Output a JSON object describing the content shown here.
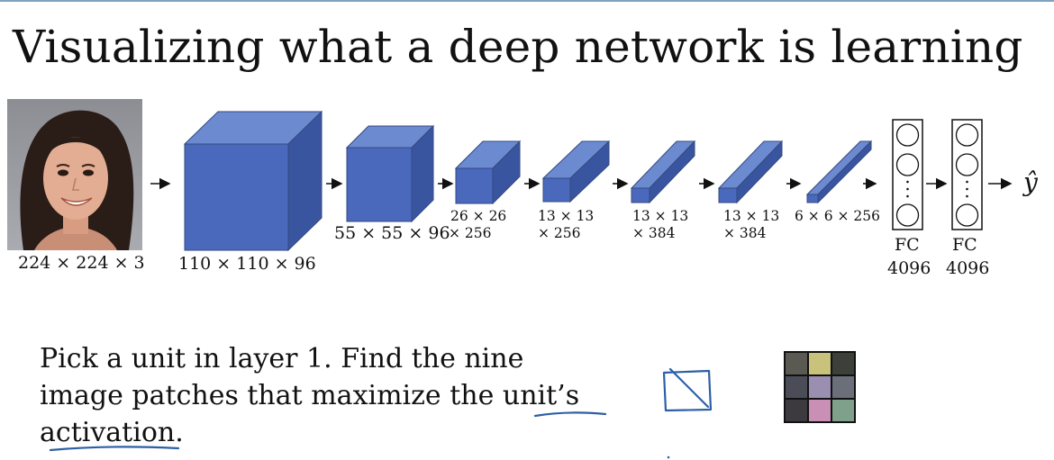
{
  "slide": {
    "title": "Visualizing what a deep network is learning"
  },
  "network": {
    "input_dim": "224 × 224 × 3",
    "layers": [
      {
        "line1": "110 × 110 × 96",
        "line2": ""
      },
      {
        "line1": "55 × 55 × 96",
        "line2": ""
      },
      {
        "line1": "26 × 26",
        "line2": "× 256"
      },
      {
        "line1": "13 × 13",
        "line2": "× 256"
      },
      {
        "line1": "13 × 13",
        "line2": "× 384"
      },
      {
        "line1": "13 × 13",
        "line2": "× 384"
      },
      {
        "line1": "6 × 6 × 256",
        "line2": ""
      }
    ],
    "fc": [
      {
        "label": "FC",
        "size": "4096"
      },
      {
        "label": "FC",
        "size": "4096"
      }
    ],
    "output_symbol": "ŷ",
    "colors": {
      "cube_front": "#4a69bd",
      "cube_top": "#6b8ad0",
      "cube_side": "#3a55a0",
      "cube_edge": "#34497f"
    }
  },
  "caption": {
    "line1": "Pick a unit in layer 1. Find the nine",
    "line2": "image patches that maximize the unit’s",
    "line3": "activation."
  },
  "patches": {
    "colors": [
      "#5a5a52",
      "#c8c27a",
      "#3d4038",
      "#4a4c58",
      "#9a8fb0",
      "#6a6f7a",
      "#3c3a3e",
      "#c98fb4",
      "#7fa08a"
    ]
  }
}
